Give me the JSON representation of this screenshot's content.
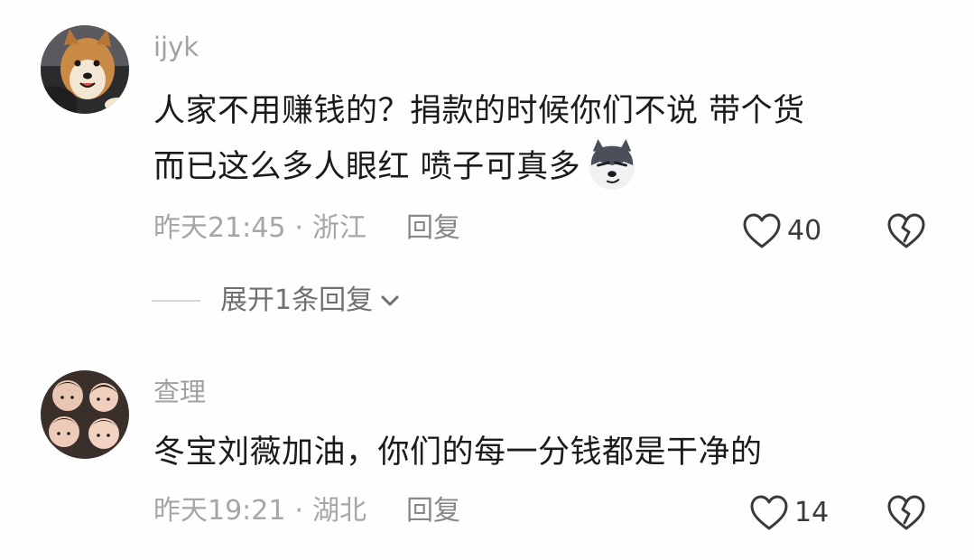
{
  "comments": [
    {
      "username": "ijyk",
      "avatar_icon": "shiba-dog-avatar",
      "lines": [
        "人家不用赚钱的？捐款的时候你们不说 带个货",
        "而已这么多人眼红  喷子可真多"
      ],
      "emoji_icon": "husky-smirk-emoji",
      "time": "昨天21:45",
      "separator": "·",
      "location": "浙江",
      "reply_label": "回复",
      "likes": "40",
      "expand_label": "展开1条回复"
    },
    {
      "username": "查理",
      "avatar_icon": "group-photo-avatar",
      "lines": [
        "冬宝刘薇加油，你们的每一分钱都是干净的"
      ],
      "time": "昨天19:21",
      "separator": "·",
      "location": "湖北",
      "reply_label": "回复",
      "likes": "14"
    }
  ],
  "colors": {
    "background": "#fefefe",
    "text_primary": "#1b1b1f",
    "text_secondary": "#a1a1a5",
    "icon_stroke": "#3a3a3e"
  }
}
